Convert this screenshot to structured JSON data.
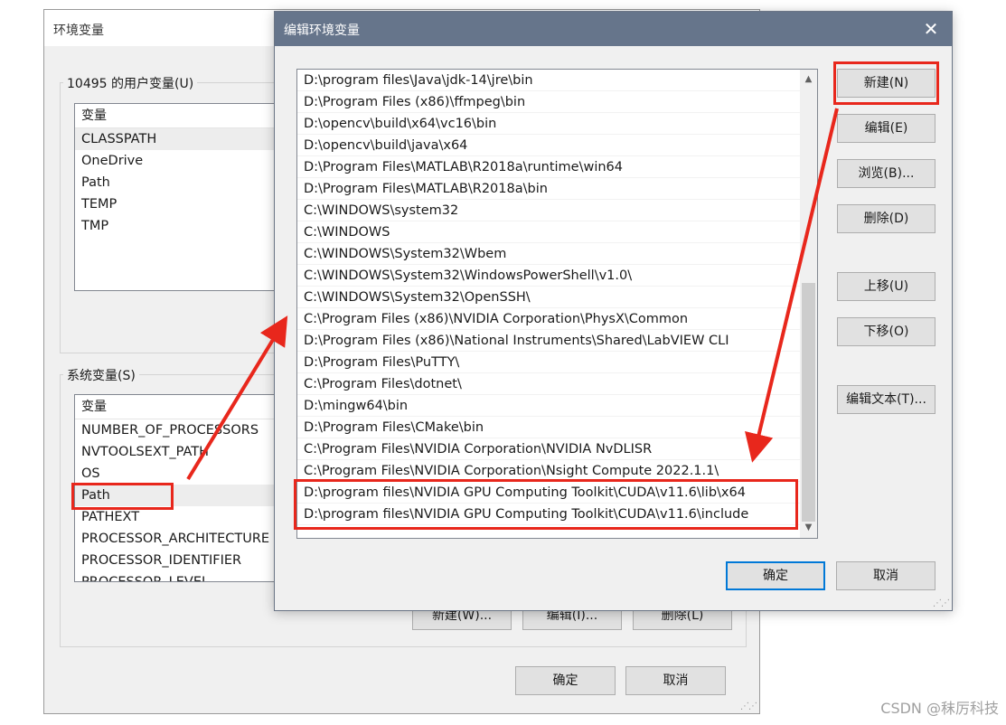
{
  "env_window": {
    "title": "环境变量",
    "user_group_label": "10495 的用户变量(U)",
    "user_vars": {
      "header": "变量",
      "rows": [
        "CLASSPATH",
        "OneDrive",
        "Path",
        "TEMP",
        "TMP"
      ]
    },
    "system_group_label": "系统变量(S)",
    "system_vars": {
      "header": "变量",
      "rows": [
        "NUMBER_OF_PROCESSORS",
        "NVTOOLSEXT_PATH",
        "OS",
        "Path",
        "PATHEXT",
        "PROCESSOR_ARCHITECTURE",
        "PROCESSOR_IDENTIFIER",
        "PROCESSOR_LEVEL"
      ]
    },
    "system_buttons": {
      "new": "新建(W)...",
      "edit": "编辑(I)...",
      "delete": "删除(L)"
    },
    "ok": "确定",
    "cancel": "取消"
  },
  "edit_dialog": {
    "title": "编辑环境变量",
    "close_glyph": "✕",
    "paths": [
      "D:\\program files\\Java\\jdk-14\\jre\\bin",
      "D:\\Program Files (x86)\\ffmpeg\\bin",
      "D:\\opencv\\build\\x64\\vc16\\bin",
      "D:\\opencv\\build\\java\\x64",
      "D:\\Program Files\\MATLAB\\R2018a\\runtime\\win64",
      "D:\\Program Files\\MATLAB\\R2018a\\bin",
      "C:\\WINDOWS\\system32",
      "C:\\WINDOWS",
      "C:\\WINDOWS\\System32\\Wbem",
      "C:\\WINDOWS\\System32\\WindowsPowerShell\\v1.0\\",
      "C:\\WINDOWS\\System32\\OpenSSH\\",
      "C:\\Program Files (x86)\\NVIDIA Corporation\\PhysX\\Common",
      "D:\\Program Files (x86)\\National Instruments\\Shared\\LabVIEW CLI",
      "D:\\Program Files\\PuTTY\\",
      "C:\\Program Files\\dotnet\\",
      "D:\\mingw64\\bin",
      "D:\\Program Files\\CMake\\bin",
      "C:\\Program Files\\NVIDIA Corporation\\NVIDIA NvDLISR",
      "C:\\Program Files\\NVIDIA Corporation\\Nsight Compute 2022.1.1\\",
      "D:\\program files\\NVIDIA GPU Computing Toolkit\\CUDA\\v11.6\\lib\\x64",
      "D:\\program files\\NVIDIA GPU Computing Toolkit\\CUDA\\v11.6\\include"
    ],
    "buttons": {
      "new": "新建(N)",
      "edit": "编辑(E)",
      "browse": "浏览(B)...",
      "delete": "删除(D)",
      "move_up": "上移(U)",
      "move_down": "下移(O)",
      "edit_text": "编辑文本(T)..."
    },
    "ok": "确定",
    "cancel": "取消"
  },
  "annotation_color": "#e8271c",
  "watermark": "CSDN @秣厉科技"
}
